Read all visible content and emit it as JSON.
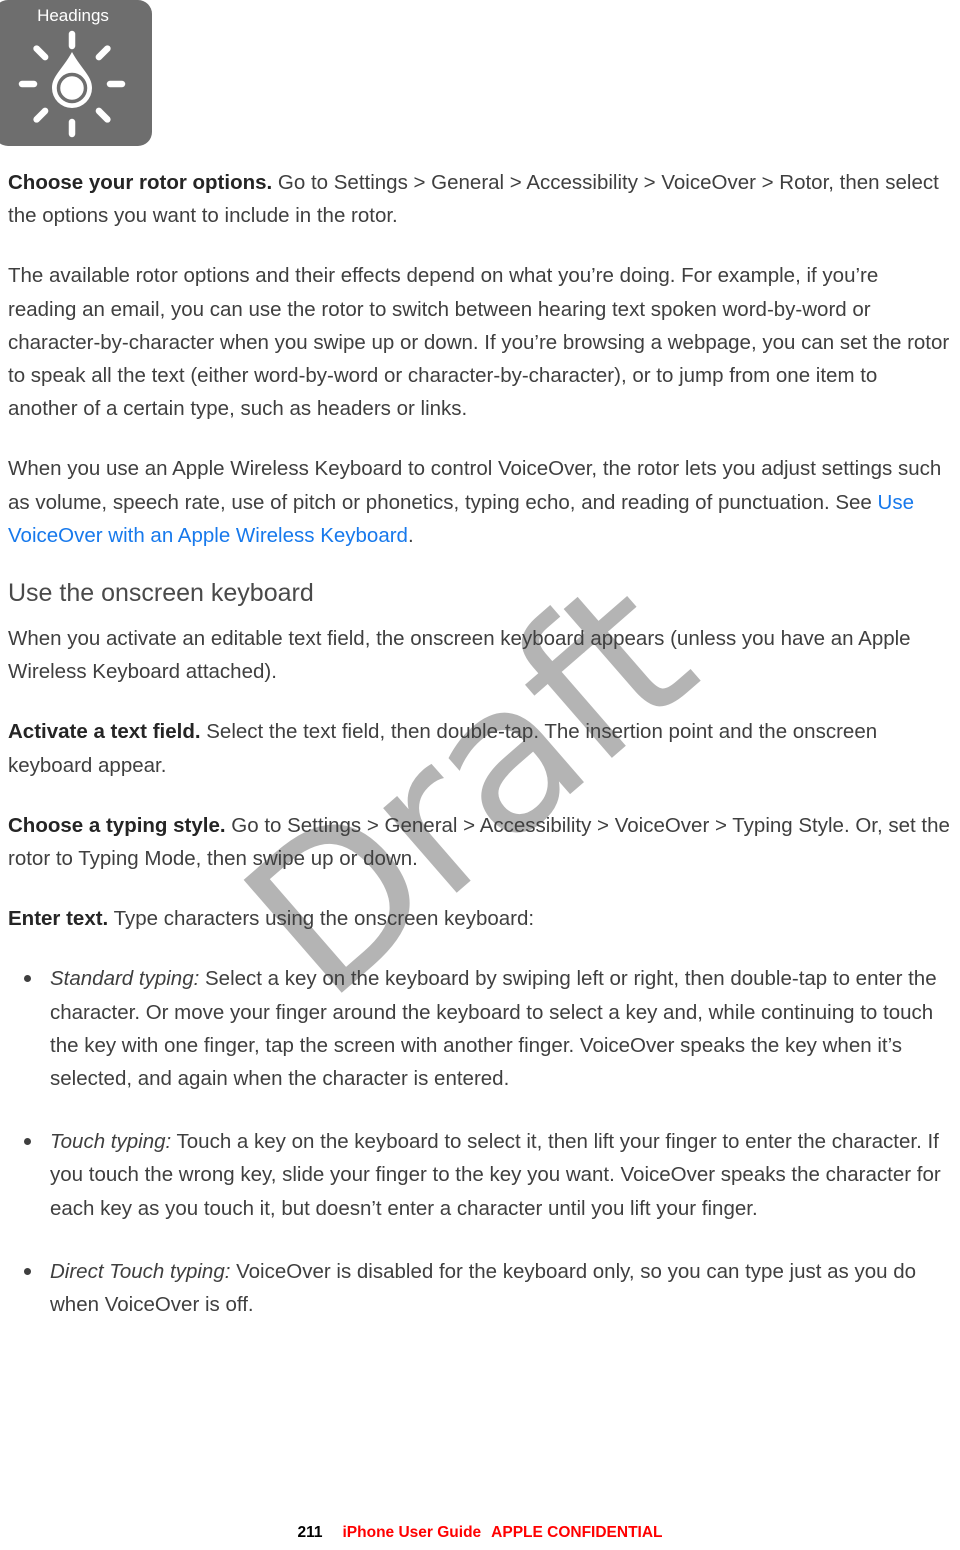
{
  "figure": {
    "rotor_label": "Headings",
    "icon_name": "voiceover-rotor-dial",
    "background_color": "#6e6e6e"
  },
  "watermark": {
    "text": "Draft",
    "color": "#b4b4b4"
  },
  "body": {
    "paragraph_1": {
      "lead": "Choose your rotor options.",
      "text": " Go to Settings > General > Accessibility > VoiceOver > Rotor, then select the options you want to include in the rotor."
    },
    "paragraph_2": {
      "text": "The available rotor options and their effects depend on what you’re doing. For example, if you’re reading an email, you can use the rotor to switch between hearing text spoken word-by-word or character-by-character when you swipe up or down. If you’re browsing a webpage, you can set the rotor to speak all the text (either word-by-word or character-by-character), or to jump from one item to another of a certain type, such as headers or links."
    },
    "paragraph_3": {
      "text_before": "When you use an Apple Wireless Keyboard to control VoiceOver, the rotor lets you adjust settings such as volume, speech rate, use of pitch or phonetics, typing echo, and reading of punctuation. See ",
      "link_text": "Use VoiceOver with an Apple Wireless Keyboard",
      "link_color": "#1779ec",
      "text_after": "."
    },
    "heading": "Use the onscreen keyboard",
    "paragraph_4": {
      "text": "When you activate an editable text field, the onscreen keyboard appears (unless you have an Apple Wireless Keyboard attached)."
    },
    "paragraph_5": {
      "lead": "Activate a text field.",
      "text": " Select the text field, then double-tap. The insertion point and the onscreen keyboard appear."
    },
    "paragraph_6": {
      "lead": "Choose a typing style.",
      "text": " Go to Settings > General > Accessibility > VoiceOver > Typing Style. Or, set the rotor to Typing Mode, then swipe up or down."
    },
    "paragraph_7": {
      "lead": "Enter text.",
      "text": " Type characters using the onscreen keyboard:"
    },
    "bullets": [
      {
        "term": "Standard typing:",
        "text": " Select a key on the keyboard by swiping left or right, then double-tap to enter the character. Or move your finger around the keyboard to select a key and, while continuing to touch the key with one finger, tap the screen with another finger. VoiceOver speaks the key when it’s selected, and again when the character is entered."
      },
      {
        "term": "Touch typing:",
        "text": " Touch a key on the keyboard to select it, then lift your finger to enter the character. If you touch the wrong key, slide your finger to the key you want. VoiceOver speaks the character for each key as you touch it, but doesn’t enter a character until you lift your finger."
      },
      {
        "term": "Direct Touch typing:",
        "text": " VoiceOver is disabled for the keyboard only, so you can type just as you do when VoiceOver is off."
      }
    ]
  },
  "footer": {
    "page_number": "211",
    "guide_name": "iPhone User Guide",
    "confidential": "APPLE CONFIDENTIAL",
    "confidential_color": "#ff0000"
  }
}
